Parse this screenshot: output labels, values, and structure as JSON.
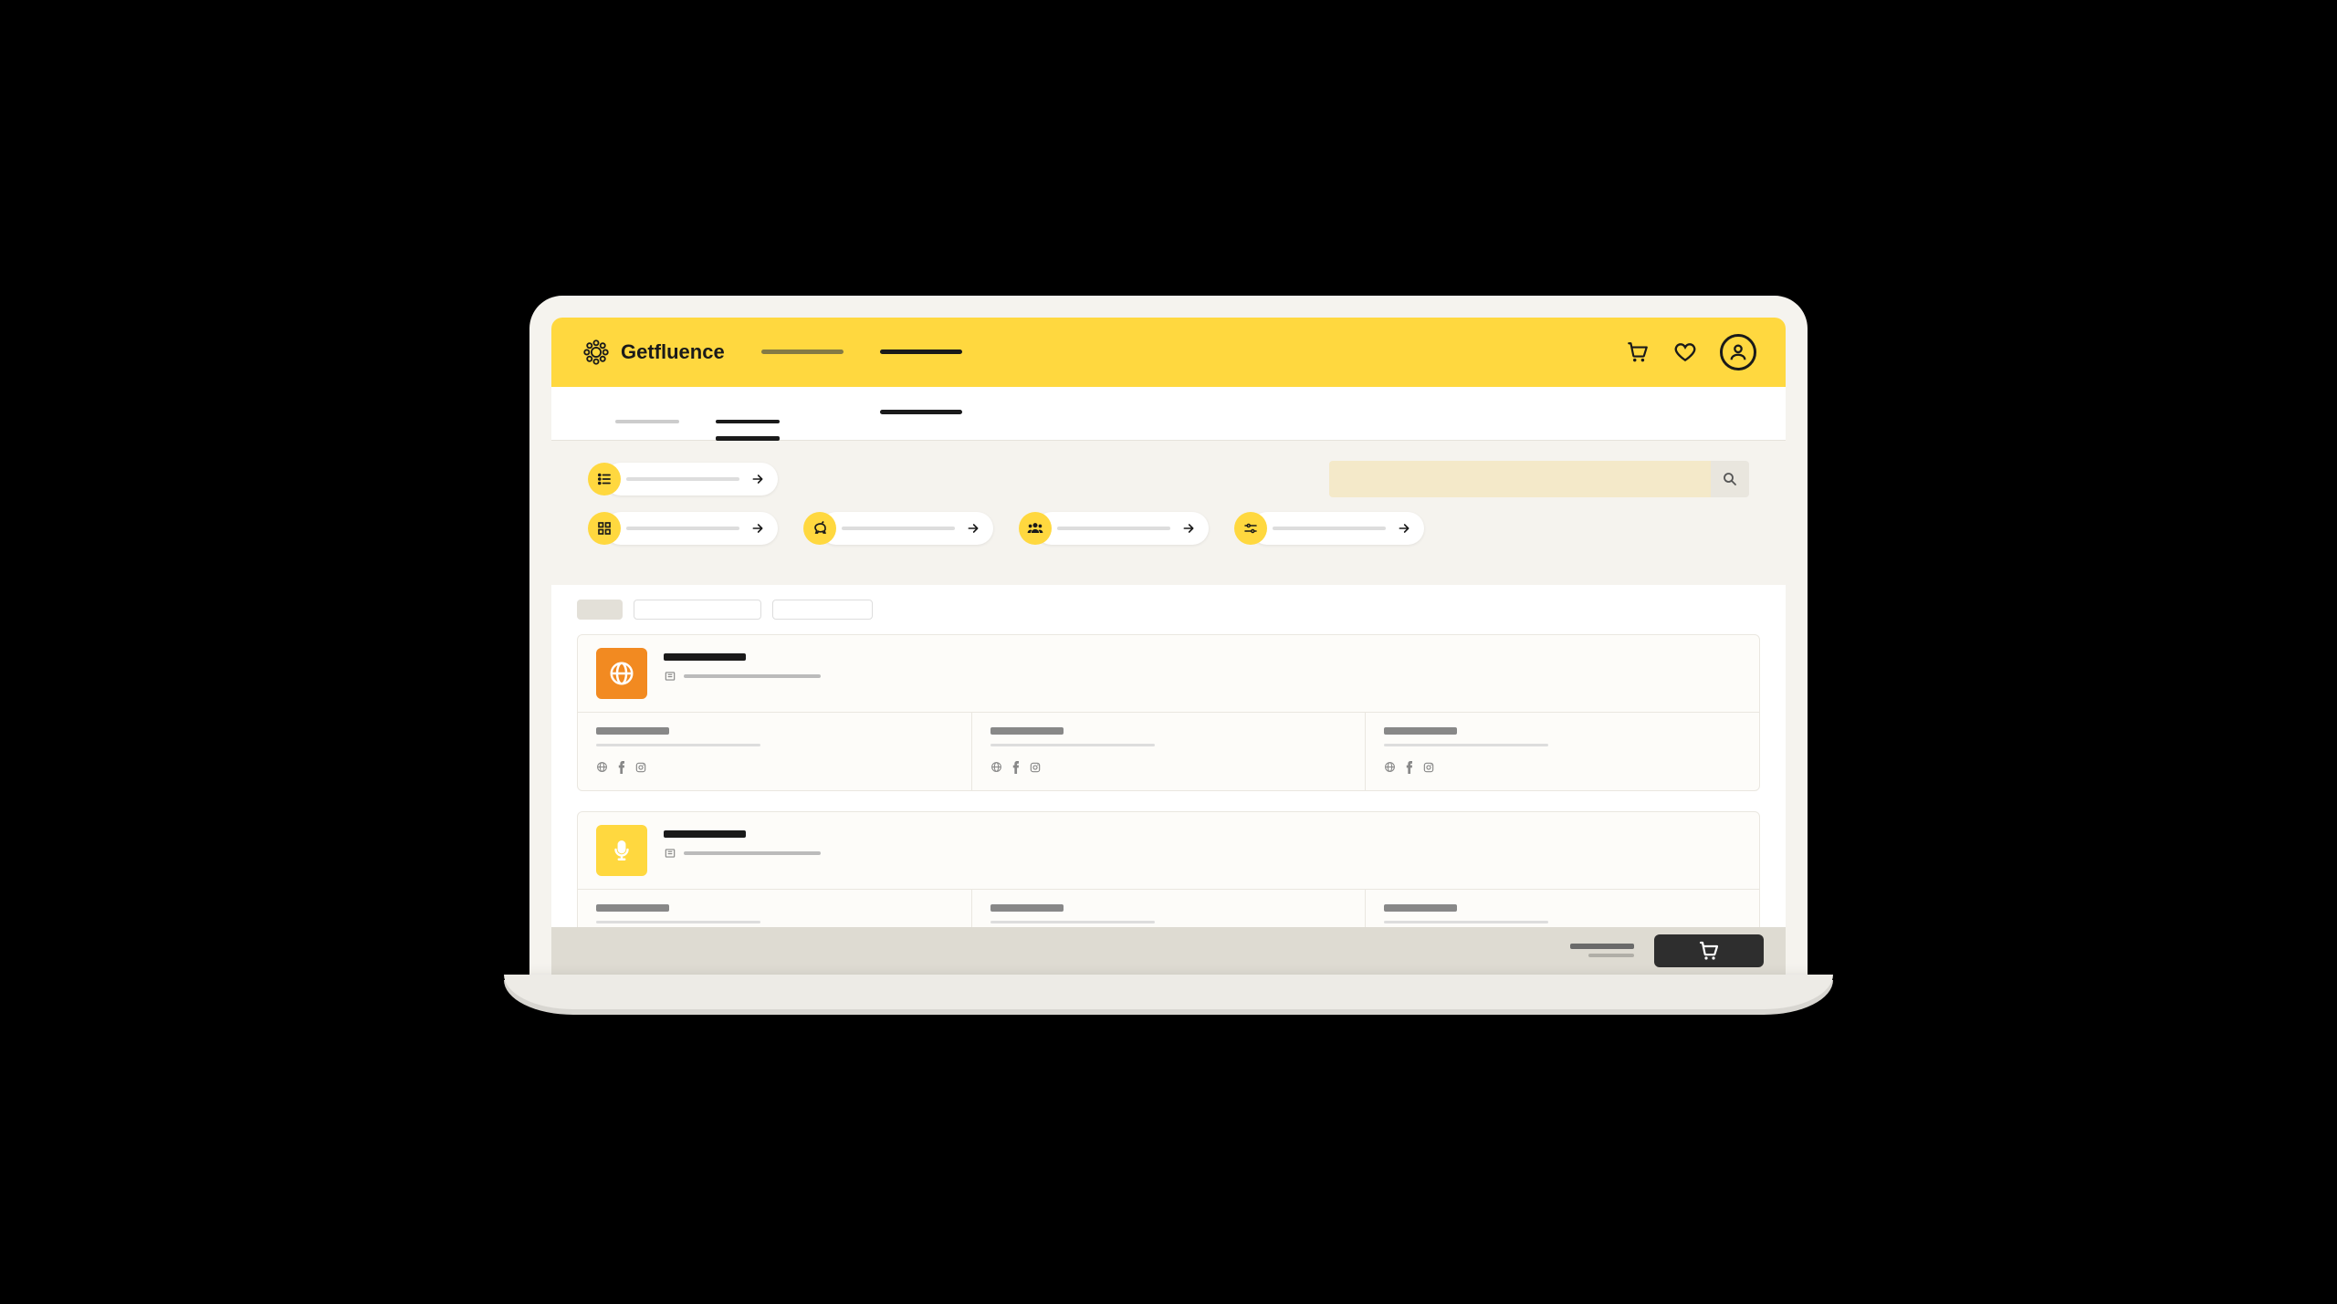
{
  "brand": {
    "name": "Getfluence"
  },
  "header": {
    "tabs": [
      {
        "active": false
      },
      {
        "active": true
      }
    ],
    "icons": {
      "cart": "cart-icon",
      "heart": "heart-icon",
      "profile": "profile-icon"
    }
  },
  "subnav": {
    "tabs": [
      {
        "active": false
      },
      {
        "active": true
      }
    ]
  },
  "filters": {
    "primary": {
      "icon": "list-icon"
    },
    "row": [
      {
        "icon": "grid-icon"
      },
      {
        "icon": "piggy-icon"
      },
      {
        "icon": "people-icon"
      },
      {
        "icon": "sliders-icon"
      }
    ],
    "search": {
      "placeholder": ""
    }
  },
  "chips": {
    "count": 3
  },
  "cards": [
    {
      "color": "orange",
      "icon": "globe-icon",
      "columns": 3
    },
    {
      "color": "yellow",
      "icon": "mic-icon",
      "columns": 3
    }
  ],
  "bottomBar": {
    "button_icon": "cart-icon"
  }
}
